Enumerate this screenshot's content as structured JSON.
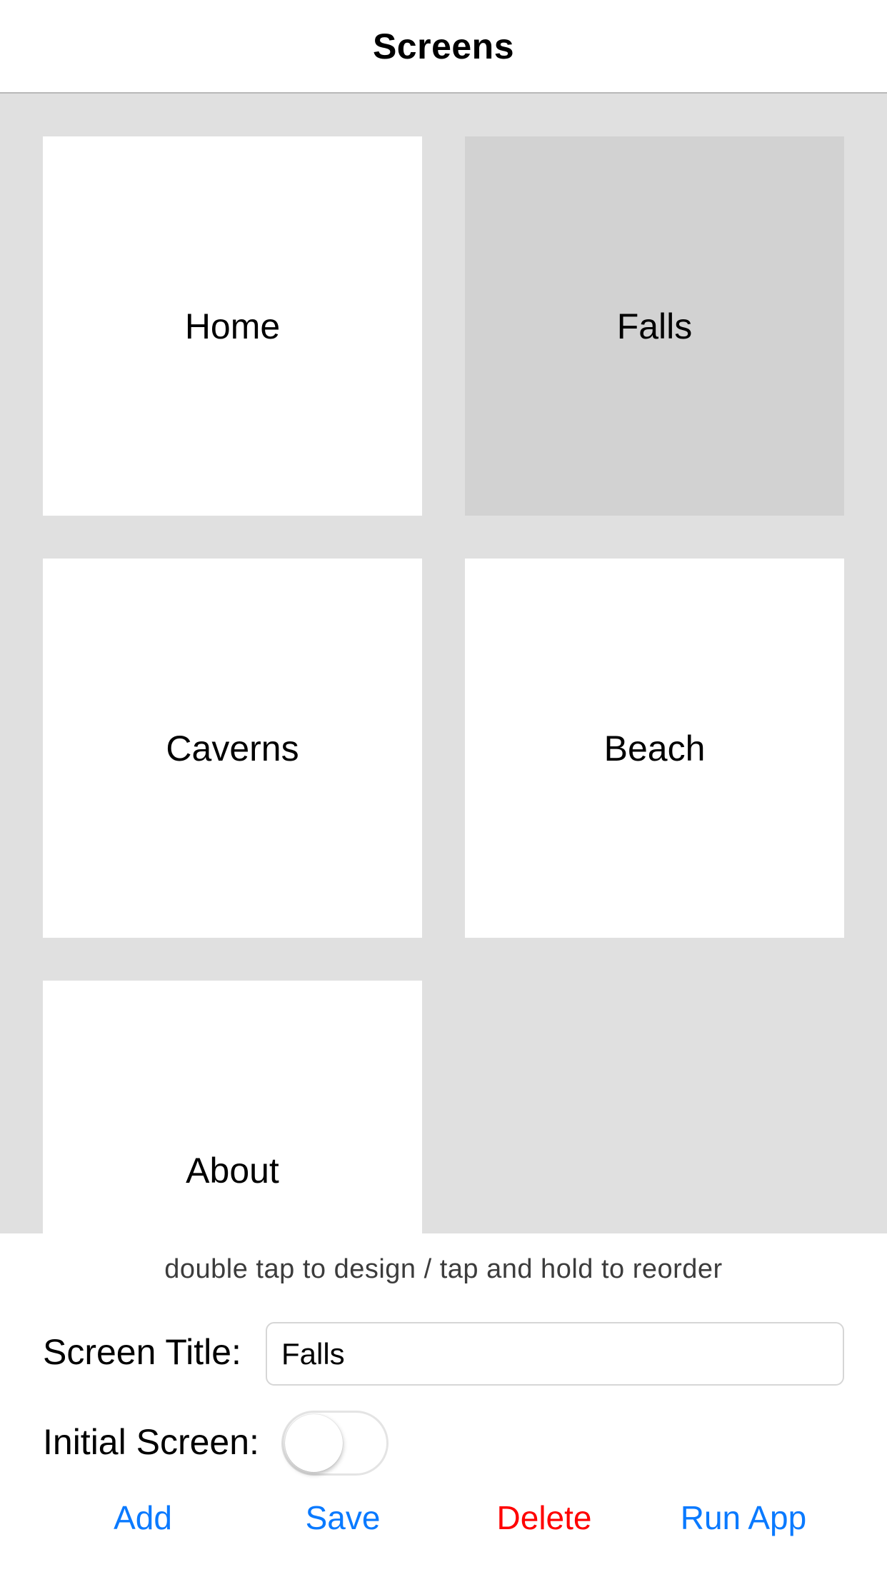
{
  "navbar": {
    "title": "Screens"
  },
  "screens": [
    {
      "label": "Home",
      "selected": false
    },
    {
      "label": "Falls",
      "selected": true
    },
    {
      "label": "Caverns",
      "selected": false
    },
    {
      "label": "Beach",
      "selected": false
    },
    {
      "label": "About",
      "selected": false
    }
  ],
  "hint": "double tap to design  /  tap and hold to reorder",
  "form": {
    "screen_title_label": "Screen Title:",
    "screen_title_value": "Falls",
    "initial_screen_label": "Initial Screen:",
    "initial_screen_on": false
  },
  "actions": {
    "add": "Add",
    "save": "Save",
    "delete": "Delete",
    "run_app": "Run App"
  },
  "colors": {
    "accent": "#0a7aff",
    "destructive": "#ff0000",
    "grid_background": "#e0e0e0",
    "selected_tile": "#d2d2d2"
  }
}
